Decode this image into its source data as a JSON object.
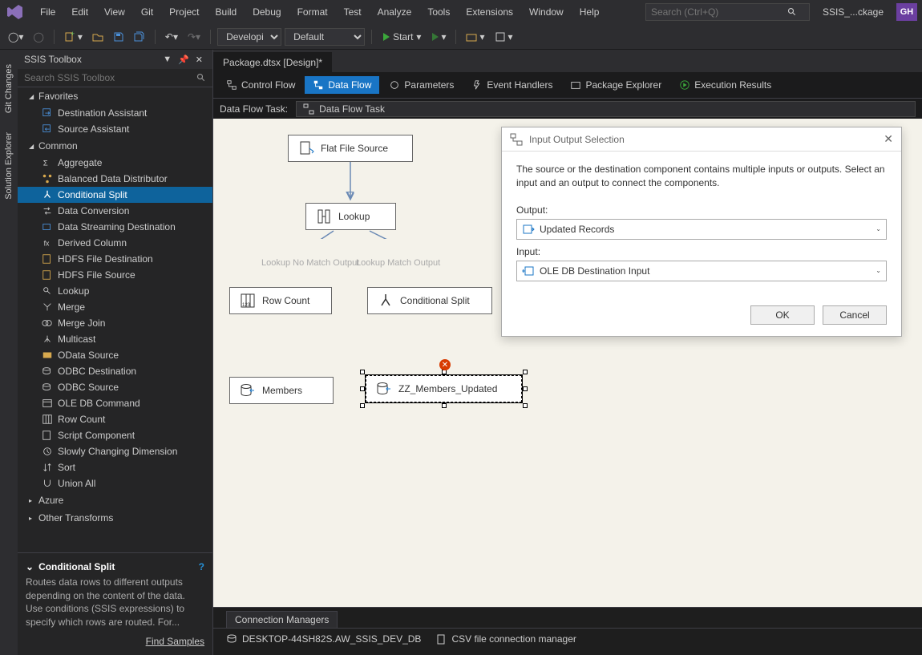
{
  "menubar": {
    "items": [
      "File",
      "Edit",
      "View",
      "Git",
      "Project",
      "Build",
      "Debug",
      "Format",
      "Test",
      "Analyze",
      "Tools",
      "Extensions",
      "Window",
      "Help"
    ],
    "search_placeholder": "Search (Ctrl+Q)",
    "solution": "SSIS_...ckage",
    "user_initials": "GH"
  },
  "toolbar": {
    "config": "Developi",
    "platform": "Default",
    "start_label": "Start"
  },
  "leftrail": {
    "tabs": [
      "Git Changes",
      "Solution Explorer"
    ]
  },
  "toolbox": {
    "title": "SSIS Toolbox",
    "search_placeholder": "Search SSIS Toolbox",
    "groups": {
      "favorites": {
        "label": "Favorites",
        "items": [
          "Destination Assistant",
          "Source Assistant"
        ]
      },
      "common": {
        "label": "Common",
        "items": [
          "Aggregate",
          "Balanced Data Distributor",
          "Conditional Split",
          "Data Conversion",
          "Data Streaming Destination",
          "Derived Column",
          "HDFS File Destination",
          "HDFS File Source",
          "Lookup",
          "Merge",
          "Merge Join",
          "Multicast",
          "OData Source",
          "ODBC Destination",
          "ODBC Source",
          "OLE DB Command",
          "Row Count",
          "Script Component",
          "Slowly Changing Dimension",
          "Sort",
          "Union All"
        ],
        "selected": "Conditional Split"
      },
      "azure": {
        "label": "Azure"
      },
      "other": {
        "label": "Other Transforms"
      }
    },
    "info": {
      "title": "Conditional Split",
      "body": "Routes data rows to different outputs depending on the content of the data. Use conditions (SSIS expressions) to specify which rows are routed. For...",
      "find_samples": "Find Samples"
    }
  },
  "document": {
    "tab": "Package.dtsx [Design]*",
    "dtabs": [
      "Control Flow",
      "Data Flow",
      "Parameters",
      "Event Handlers",
      "Package Explorer",
      "Execution Results"
    ],
    "active_dtab": "Data Flow",
    "dft_label": "Data Flow Task:",
    "dft_value": "Data Flow Task"
  },
  "canvas": {
    "nodes": {
      "flatfile": "Flat File Source",
      "lookup": "Lookup",
      "rowcount": "Row Count",
      "condsplit": "Conditional Split",
      "members": "Members",
      "zzupdated": "ZZ_Members_Updated"
    },
    "edge_labels": {
      "nomatch": "Lookup No Match Output",
      "match": "Lookup Match Output"
    }
  },
  "dialog": {
    "title": "Input Output Selection",
    "message": "The source or the destination component contains multiple inputs or outputs. Select an input and an output to connect the components.",
    "output_label": "Output:",
    "output_value": "Updated Records",
    "input_label": "Input:",
    "input_value": "OLE DB Destination Input",
    "ok": "OK",
    "cancel": "Cancel"
  },
  "connections": {
    "tab": "Connection Managers",
    "items": [
      "DESKTOP-44SH82S.AW_SSIS_DEV_DB",
      "CSV file connection manager"
    ]
  }
}
